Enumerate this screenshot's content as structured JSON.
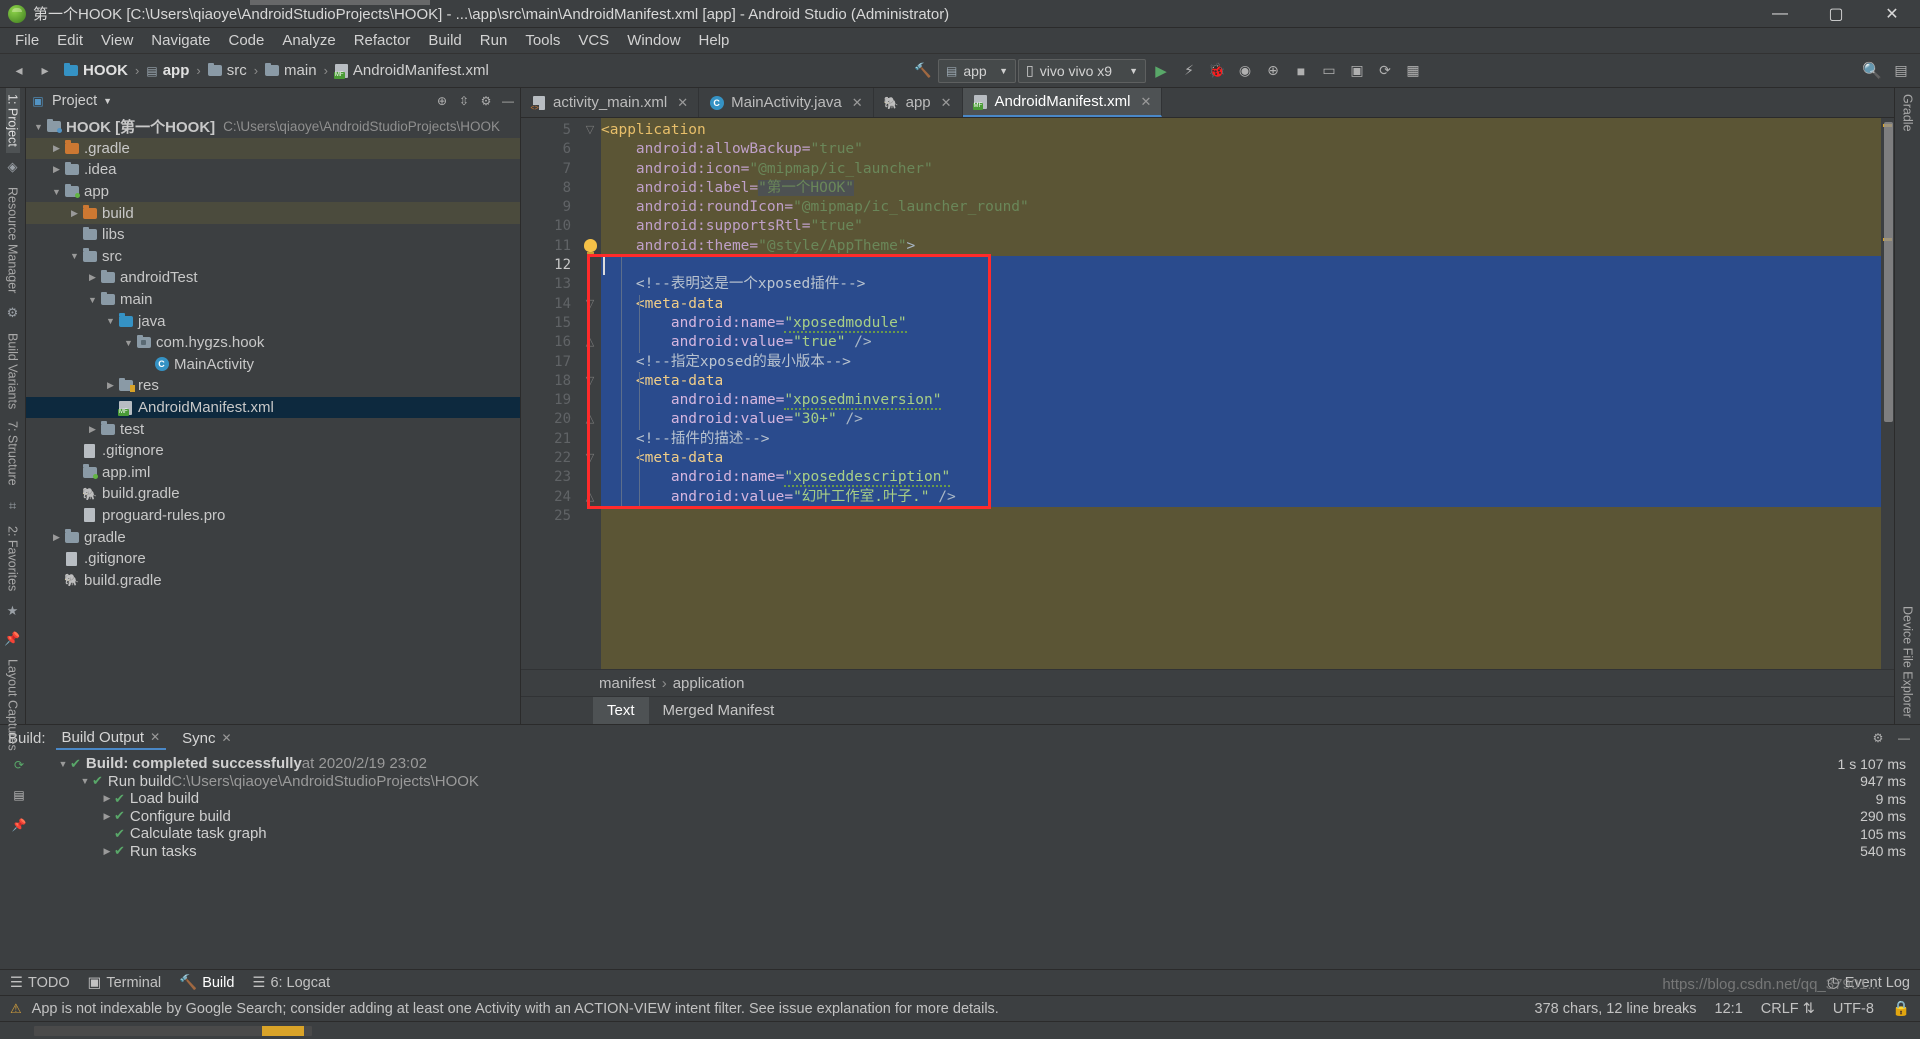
{
  "window": {
    "title": "第一个HOOK [C:\\Users\\qiaoye\\AndroidStudioProjects\\HOOK] - ...\\app\\src\\main\\AndroidManifest.xml [app] - Android Studio (Administrator)",
    "minimize": "—",
    "maximize": "▢",
    "close": "✕"
  },
  "menu": [
    "File",
    "Edit",
    "View",
    "Navigate",
    "Code",
    "Analyze",
    "Refactor",
    "Build",
    "Run",
    "Tools",
    "VCS",
    "Window",
    "Help"
  ],
  "toolbar": {
    "breadcrumbs": [
      {
        "label": "HOOK",
        "icon": "project-icon"
      },
      {
        "label": "app",
        "icon": "module-icon"
      },
      {
        "label": "src",
        "icon": "folder-icon"
      },
      {
        "label": "main",
        "icon": "folder-icon"
      },
      {
        "label": "AndroidManifest.xml",
        "icon": "manifest-icon"
      }
    ],
    "separator": "›",
    "run_config": "app",
    "device": "vivo vivo x9",
    "icons": [
      "hammer-icon",
      "run-icon",
      "debug-icon",
      "attach-debugger-icon",
      "profile-icon",
      "stop-icon",
      "avd-manager-icon",
      "sdk-manager-icon",
      "sync-gradle-icon",
      "search-everywhere-icon",
      "project-structure-icon"
    ]
  },
  "project_pane": {
    "title": "Project",
    "dropdown_caret": "▾",
    "actions": [
      "locate-icon",
      "collapse-all-icon",
      "settings-icon",
      "hide-icon"
    ],
    "tree": [
      {
        "indent": 0,
        "arrow": "▼",
        "icon": "project-folder",
        "label": "HOOK [第一个HOOK]",
        "sub": "C:\\Users\\qiaoye\\AndroidStudioProjects\\HOOK",
        "bold": true,
        "state": "normal"
      },
      {
        "indent": 1,
        "arrow": "▶",
        "icon": "folder-orange",
        "label": ".gradle",
        "sub": "",
        "state": "alt"
      },
      {
        "indent": 1,
        "arrow": "▶",
        "icon": "folder-gray",
        "label": ".idea",
        "sub": "",
        "state": "normal"
      },
      {
        "indent": 1,
        "arrow": "▼",
        "icon": "folder-module",
        "label": "app",
        "sub": "",
        "state": "normal"
      },
      {
        "indent": 2,
        "arrow": "▶",
        "icon": "folder-orange",
        "label": "build",
        "sub": "",
        "state": "alt"
      },
      {
        "indent": 2,
        "arrow": "",
        "icon": "folder-gray",
        "label": "libs",
        "sub": "",
        "state": "normal"
      },
      {
        "indent": 2,
        "arrow": "▼",
        "icon": "folder-gray",
        "label": "src",
        "sub": "",
        "state": "normal"
      },
      {
        "indent": 3,
        "arrow": "▶",
        "icon": "folder-gray",
        "label": "androidTest",
        "sub": "",
        "state": "normal"
      },
      {
        "indent": 3,
        "arrow": "▼",
        "icon": "folder-gray",
        "label": "main",
        "sub": "",
        "state": "normal"
      },
      {
        "indent": 4,
        "arrow": "▼",
        "icon": "folder-blue",
        "label": "java",
        "sub": "",
        "state": "normal"
      },
      {
        "indent": 5,
        "arrow": "▼",
        "icon": "package-icon",
        "label": "com.hygzs.hook",
        "sub": "",
        "state": "normal"
      },
      {
        "indent": 6,
        "arrow": "",
        "icon": "class-icon",
        "label": "MainActivity",
        "sub": "",
        "state": "normal"
      },
      {
        "indent": 4,
        "arrow": "▶",
        "icon": "folder-res",
        "label": "res",
        "sub": "",
        "state": "normal"
      },
      {
        "indent": 4,
        "arrow": "",
        "icon": "manifest-icon",
        "label": "AndroidManifest.xml",
        "sub": "",
        "state": "selected"
      },
      {
        "indent": 3,
        "arrow": "▶",
        "icon": "folder-gray",
        "label": "test",
        "sub": "",
        "state": "normal"
      },
      {
        "indent": 2,
        "arrow": "",
        "icon": "file-icon",
        "label": ".gitignore",
        "sub": "",
        "state": "normal"
      },
      {
        "indent": 2,
        "arrow": "",
        "icon": "iml-icon",
        "label": "app.iml",
        "sub": "",
        "state": "normal"
      },
      {
        "indent": 2,
        "arrow": "",
        "icon": "gradle-icon",
        "label": "build.gradle",
        "sub": "",
        "state": "normal"
      },
      {
        "indent": 2,
        "arrow": "",
        "icon": "file-icon",
        "label": "proguard-rules.pro",
        "sub": "",
        "state": "normal"
      },
      {
        "indent": 1,
        "arrow": "▶",
        "icon": "folder-gray",
        "label": "gradle",
        "sub": "",
        "state": "normal"
      },
      {
        "indent": 1,
        "arrow": "",
        "icon": "file-icon",
        "label": ".gitignore",
        "sub": "",
        "state": "normal"
      },
      {
        "indent": 1,
        "arrow": "",
        "icon": "gradle-icon",
        "label": "build.gradle",
        "sub": "",
        "state": "normal"
      }
    ]
  },
  "left_rail": [
    {
      "label": "1: Project",
      "selected": true
    },
    {
      "label": "Resource Manager",
      "selected": false
    },
    {
      "label": "Build Variants",
      "selected": false
    },
    {
      "label": "7: Structure",
      "selected": false
    },
    {
      "label": "2: Favorites",
      "selected": false
    },
    {
      "label": "Layout Captures",
      "selected": false
    }
  ],
  "right_rail": [
    {
      "label": "Gradle"
    },
    {
      "label": "Device File Explorer"
    }
  ],
  "editor_tabs": [
    {
      "label": "activity_main.xml",
      "icon": "layout-xml-icon",
      "active": false,
      "close": "✕"
    },
    {
      "label": "MainActivity.java",
      "icon": "java-class-icon",
      "active": false,
      "close": "✕"
    },
    {
      "label": "app",
      "icon": "gradle-icon",
      "active": false,
      "close": "✕"
    },
    {
      "label": "AndroidManifest.xml",
      "icon": "manifest-icon",
      "active": true,
      "close": "✕"
    }
  ],
  "code": {
    "first_line_no": 5,
    "lines": [
      {
        "no": 5,
        "selected": false,
        "tokens": [
          {
            "t": "<application",
            "c": "tag"
          }
        ],
        "indent": 0
      },
      {
        "no": 6,
        "selected": false,
        "tokens": [
          {
            "t": "    android:allowBackup=",
            "c": "attr"
          },
          {
            "t": "\"true\"",
            "c": "val"
          }
        ],
        "indent": 1
      },
      {
        "no": 7,
        "selected": false,
        "tokens": [
          {
            "t": "    android:icon=",
            "c": "attr"
          },
          {
            "t": "\"@mipmap/ic_launcher\"",
            "c": "val"
          }
        ],
        "indent": 1
      },
      {
        "no": 8,
        "selected": false,
        "tokens": [
          {
            "t": "    android:label=",
            "c": "attr"
          },
          {
            "t": "\"第一个HOOK\"",
            "c": "val-hl"
          }
        ],
        "indent": 1
      },
      {
        "no": 9,
        "selected": false,
        "tokens": [
          {
            "t": "    android:roundIcon=",
            "c": "attr"
          },
          {
            "t": "\"@mipmap/ic_launcher_round\"",
            "c": "val"
          }
        ],
        "indent": 1
      },
      {
        "no": 10,
        "selected": false,
        "tokens": [
          {
            "t": "    android:supportsRtl=",
            "c": "attr"
          },
          {
            "t": "\"true\"",
            "c": "val"
          }
        ],
        "indent": 1
      },
      {
        "no": 11,
        "selected": false,
        "tokens": [
          {
            "t": "    android:theme=",
            "c": "attr"
          },
          {
            "t": "\"@style/AppTheme\"",
            "c": "val"
          },
          {
            "t": ">",
            "c": "punct"
          }
        ],
        "indent": 1
      },
      {
        "no": 12,
        "selected": true,
        "tokens": [],
        "indent": 0
      },
      {
        "no": 13,
        "selected": true,
        "tokens": [
          {
            "t": "    <!--表明这是一个xposed插件-->",
            "c": "cmt"
          }
        ],
        "indent": 1
      },
      {
        "no": 14,
        "selected": true,
        "tokens": [
          {
            "t": "    <meta-data",
            "c": "tag"
          }
        ],
        "indent": 1
      },
      {
        "no": 15,
        "selected": true,
        "tokens": [
          {
            "t": "        android:name=",
            "c": "attr"
          },
          {
            "t": "\"xposedmodule\"",
            "c": "val-squig"
          }
        ],
        "indent": 2
      },
      {
        "no": 16,
        "selected": true,
        "tokens": [
          {
            "t": "        android:value=",
            "c": "attr"
          },
          {
            "t": "\"true\"",
            "c": "val"
          },
          {
            "t": " />",
            "c": "punct"
          }
        ],
        "indent": 2
      },
      {
        "no": 17,
        "selected": true,
        "tokens": [
          {
            "t": "    <!--指定xposed的最小版本-->",
            "c": "cmt"
          }
        ],
        "indent": 1
      },
      {
        "no": 18,
        "selected": true,
        "tokens": [
          {
            "t": "    <meta-data",
            "c": "tag"
          }
        ],
        "indent": 1
      },
      {
        "no": 19,
        "selected": true,
        "tokens": [
          {
            "t": "        android:name=",
            "c": "attr"
          },
          {
            "t": "\"xposedminversion\"",
            "c": "val-squig"
          }
        ],
        "indent": 2
      },
      {
        "no": 20,
        "selected": true,
        "tokens": [
          {
            "t": "        android:value=",
            "c": "attr"
          },
          {
            "t": "\"30+\"",
            "c": "val"
          },
          {
            "t": " />",
            "c": "punct"
          }
        ],
        "indent": 2
      },
      {
        "no": 21,
        "selected": true,
        "tokens": [
          {
            "t": "    <!--插件的描述-->",
            "c": "cmt"
          }
        ],
        "indent": 1
      },
      {
        "no": 22,
        "selected": true,
        "tokens": [
          {
            "t": "    <meta-data",
            "c": "tag"
          }
        ],
        "indent": 1
      },
      {
        "no": 23,
        "selected": true,
        "tokens": [
          {
            "t": "        android:name=",
            "c": "attr"
          },
          {
            "t": "\"xposeddescription\"",
            "c": "val-squig"
          }
        ],
        "indent": 2
      },
      {
        "no": 24,
        "selected": true,
        "tokens": [
          {
            "t": "        android:value=",
            "c": "attr"
          },
          {
            "t": "\"幻叶工作室.叶子.\"",
            "c": "val"
          },
          {
            "t": " />",
            "c": "punct"
          }
        ],
        "indent": 2
      },
      {
        "no": 25,
        "selected": false,
        "tokens": [],
        "indent": 0
      }
    ]
  },
  "breadcrumbs_editor": {
    "items": [
      "manifest",
      "application"
    ],
    "separator": "›"
  },
  "editor_bottom_tabs": [
    {
      "label": "Text",
      "selected": true
    },
    {
      "label": "Merged Manifest",
      "selected": false
    }
  ],
  "build_panel": {
    "label": "Build:",
    "tabs": [
      {
        "label": "Build Output",
        "selected": true,
        "close": "✕"
      },
      {
        "label": "Sync",
        "selected": false,
        "close": "✕"
      }
    ],
    "actions": [
      "settings-icon",
      "hide-icon"
    ],
    "side_actions": [
      "rerun-icon",
      "filter-icon",
      "pin-icon"
    ],
    "rows": [
      {
        "indent": 0,
        "tri": "▼",
        "check": "✔",
        "text": "Build: completed successfully",
        "bold": true,
        "gray": " at 2020/2/19 23:02",
        "time": "1 s 107 ms"
      },
      {
        "indent": 1,
        "tri": "▼",
        "check": "✔",
        "text": "Run build",
        "bold": false,
        "gray": " C:\\Users\\qiaoye\\AndroidStudioProjects\\HOOK",
        "time": "947 ms"
      },
      {
        "indent": 2,
        "tri": "▶",
        "check": "✔",
        "text": "Load build",
        "bold": false,
        "gray": "",
        "time": "9 ms"
      },
      {
        "indent": 2,
        "tri": "▶",
        "check": "✔",
        "text": "Configure build",
        "bold": false,
        "gray": "",
        "time": "290 ms"
      },
      {
        "indent": 2,
        "tri": "",
        "check": "✔",
        "text": "Calculate task graph",
        "bold": false,
        "gray": "",
        "time": "105 ms"
      },
      {
        "indent": 2,
        "tri": "▶",
        "check": "✔",
        "text": "Run tasks",
        "bold": false,
        "gray": "",
        "time": "540 ms"
      }
    ]
  },
  "bottom_strip": {
    "items": [
      {
        "label": "TODO",
        "icon": "todo-icon",
        "selected": false
      },
      {
        "label": "Terminal",
        "icon": "terminal-icon",
        "selected": false
      },
      {
        "label": "Build",
        "icon": "build-icon",
        "selected": true
      },
      {
        "label": "6: Logcat",
        "icon": "logcat-icon",
        "selected": false
      }
    ],
    "right": [
      {
        "label": "Event Log",
        "icon": "event-log-icon"
      }
    ]
  },
  "statusbar": {
    "message": "App is not indexable by Google Search; consider adding at least one Activity with an ACTION-VIEW intent filter. See issue explanation for more details.",
    "chars": "378 chars, 12 line breaks",
    "caret": "12:1",
    "line_sep": "CRLF",
    "line_sep_caret": "⇅",
    "encoding": "UTF-8",
    "lock": "🔒",
    "watermark": "https://blog.csdn.net/qq_37901..."
  },
  "colors": {
    "accent": "#4a88c7",
    "selection": "#2a4b8d",
    "highlight_box": "#ff2b2b",
    "editor_bg": "#5b5535",
    "panel_bg": "#3c3f41",
    "success": "#59a869"
  }
}
